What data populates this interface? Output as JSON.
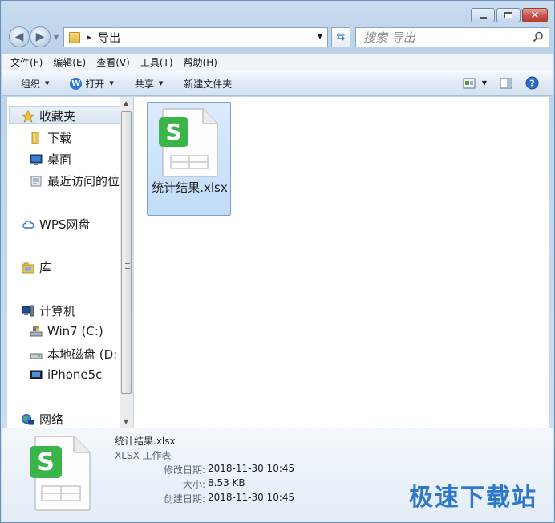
{
  "window": {
    "controls": {
      "minimize": "minimize",
      "maximize": "maximize",
      "close": "✕"
    }
  },
  "navigation": {
    "address_path": "导出",
    "search_placeholder": "搜索 导出"
  },
  "menu": {
    "items": [
      "文件(F)",
      "编辑(E)",
      "查看(V)",
      "工具(T)",
      "帮助(H)"
    ]
  },
  "commands": {
    "organize": "组织",
    "open": "打开",
    "share": "共享",
    "new_folder": "新建文件夹"
  },
  "sidebar": {
    "favorites_label": "收藏夹",
    "favorites": [
      "下载",
      "桌面",
      "最近访问的位"
    ],
    "wps_label": "WPS网盘",
    "library_label": "库",
    "computer_label": "计算机",
    "drives": [
      "Win7 (C:)",
      "本地磁盘 (D:",
      "iPhone5c"
    ],
    "network_label": "网络"
  },
  "files": [
    {
      "name": "统计结果.xlsx",
      "icon": "wps-spreadsheet-icon",
      "icon_letter": "S",
      "selected": true
    }
  ],
  "details": {
    "file_name": "统计结果.xlsx",
    "file_type": "XLSX 工作表",
    "modified_label": "修改日期:",
    "modified_value": "2018-11-30 10:45",
    "size_label": "大小:",
    "size_value": "8.53 KB",
    "created_label": "创建日期:",
    "created_value": "2018-11-30 10:45",
    "icon_letter": "S"
  },
  "watermark": "极速下载站",
  "colors": {
    "wps_green": "#3bb54a",
    "accent_blue": "#2f78c8",
    "selection": "#cce2fa"
  }
}
